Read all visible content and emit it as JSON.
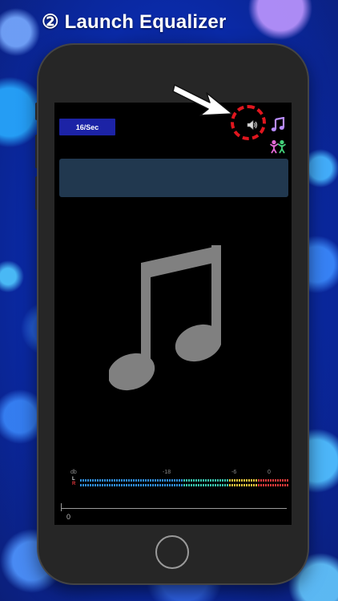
{
  "title": "② Launch Equalizer",
  "player": {
    "rate_label": "16/Sec",
    "elapsed_time": "0",
    "meter": {
      "unit_label": "db",
      "left_channel": "L",
      "right_channel": "R",
      "ticks": [
        "-18",
        "-6",
        "0"
      ]
    }
  },
  "icons": {
    "equalizer": "speaker-icon",
    "music_library": "music-note-icon",
    "people": "people-icon",
    "artwork": "music-note-icon",
    "pointer": "arrow-icon"
  },
  "colors": {
    "highlight_ring": "#e0161e",
    "rate_badge": "#1c23a6",
    "info_bar": "#21384f",
    "music_icon": "#b98cff"
  }
}
